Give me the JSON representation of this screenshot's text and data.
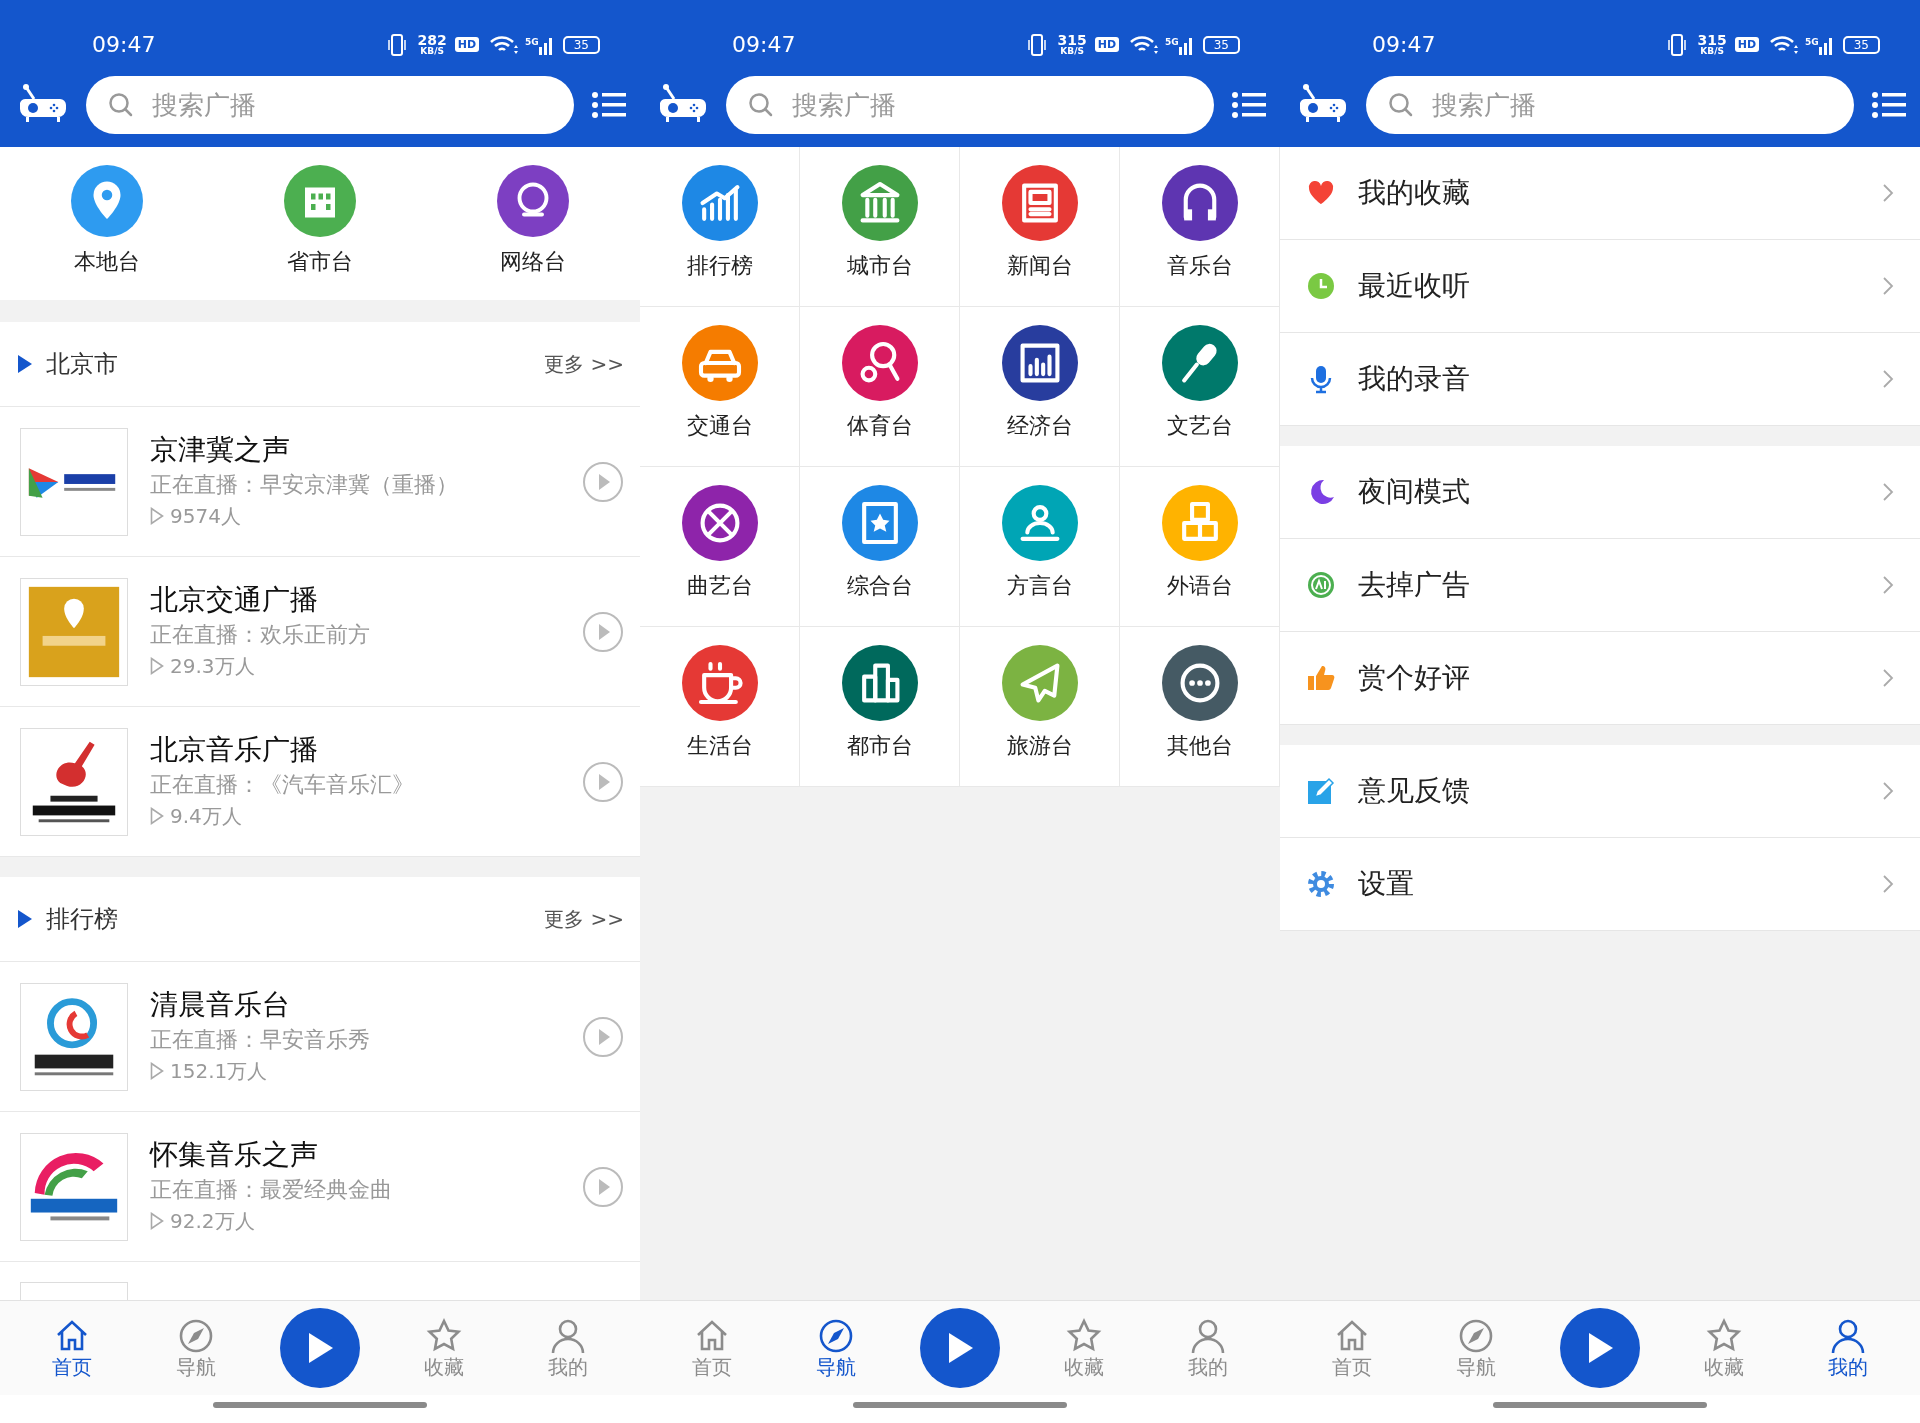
{
  "screens": [
    {
      "kind": "home",
      "status_bar": {
        "time": "09:47",
        "speed": "282",
        "speed_unit": "KB/S",
        "hd": "HD",
        "network": "5G",
        "battery": "35"
      },
      "search": {
        "placeholder": "搜索广播"
      },
      "categories": [
        {
          "label": "本地台",
          "color": "#2e9bf0"
        },
        {
          "label": "省市台",
          "color": "#4caf50"
        },
        {
          "label": "网络台",
          "color": "#7d3fc2"
        }
      ],
      "sections": [
        {
          "title": "北京市",
          "more": "更多 >>",
          "stations": [
            {
              "name": "京津冀之声",
              "now_playing": "正在直播：早安京津冀（重播）",
              "listeners": "9574人"
            },
            {
              "name": "北京交通广播",
              "now_playing": "正在直播：欢乐正前方",
              "listeners": "29.3万人"
            },
            {
              "name": "北京音乐广播",
              "now_playing": "正在直播：《汽车音乐汇》",
              "listeners": "9.4万人"
            }
          ]
        },
        {
          "title": "排行榜",
          "more": "更多 >>",
          "stations": [
            {
              "name": "清晨音乐台",
              "now_playing": "正在直播：早安音乐秀",
              "listeners": "152.1万人"
            },
            {
              "name": "怀集音乐之声",
              "now_playing": "正在直播：最爱经典金曲",
              "listeners": "92.2万人"
            }
          ]
        }
      ],
      "bottom_nav": [
        {
          "kind": "tab",
          "label": "首页",
          "selected": true
        },
        {
          "kind": "tab",
          "label": "导航",
          "selected": false
        },
        {
          "kind": "play"
        },
        {
          "kind": "tab",
          "label": "收藏",
          "selected": false
        },
        {
          "kind": "tab",
          "label": "我的",
          "selected": false
        }
      ]
    },
    {
      "kind": "navigate",
      "status_bar": {
        "time": "09:47",
        "speed": "315",
        "speed_unit": "KB/S",
        "hd": "HD",
        "network": "5G",
        "battery": "35"
      },
      "search": {
        "placeholder": "搜索广播"
      },
      "categories": [
        {
          "label": "排行榜",
          "color": "#1e88e5"
        },
        {
          "label": "城市台",
          "color": "#43a047"
        },
        {
          "label": "新闻台",
          "color": "#e53935"
        },
        {
          "label": "音乐台",
          "color": "#5e35b1"
        },
        {
          "label": "交通台",
          "color": "#f57c00"
        },
        {
          "label": "体育台",
          "color": "#d81b60"
        },
        {
          "label": "经济台",
          "color": "#283d9e"
        },
        {
          "label": "文艺台",
          "color": "#00796b"
        },
        {
          "label": "曲艺台",
          "color": "#8e24aa"
        },
        {
          "label": "综合台",
          "color": "#1e88e5"
        },
        {
          "label": "方言台",
          "color": "#00a5b5"
        },
        {
          "label": "外语台",
          "color": "#ffb300"
        },
        {
          "label": "生活台",
          "color": "#e53935"
        },
        {
          "label": "都市台",
          "color": "#00695c"
        },
        {
          "label": "旅游台",
          "color": "#7cb342"
        },
        {
          "label": "其他台",
          "color": "#455a64"
        }
      ],
      "bottom_nav": [
        {
          "kind": "tab",
          "label": "首页",
          "selected": false
        },
        {
          "kind": "tab",
          "label": "导航",
          "selected": true
        },
        {
          "kind": "play"
        },
        {
          "kind": "tab",
          "label": "收藏",
          "selected": false
        },
        {
          "kind": "tab",
          "label": "我的",
          "selected": false
        }
      ]
    },
    {
      "kind": "mine",
      "status_bar": {
        "time": "09:47",
        "speed": "315",
        "speed_unit": "KB/S",
        "hd": "HD",
        "network": "5G",
        "battery": "35"
      },
      "search": {
        "placeholder": "搜索广播"
      },
      "menu_groups": [
        [
          {
            "label": "我的收藏",
            "color": "#f44336"
          },
          {
            "label": "最近收听",
            "color": "#7ac943"
          },
          {
            "label": "我的录音",
            "color": "#1e6fe0"
          }
        ],
        [
          {
            "label": "夜间模式",
            "color": "#7b3fe4"
          },
          {
            "label": "去掉广告",
            "color": "#4caf50"
          },
          {
            "label": "赏个好评",
            "color": "#f7931e"
          }
        ],
        [
          {
            "label": "意见反馈",
            "color": "#29a3e8"
          },
          {
            "label": "设置",
            "color": "#3f8be0"
          }
        ]
      ],
      "bottom_nav": [
        {
          "kind": "tab",
          "label": "首页",
          "selected": false
        },
        {
          "kind": "tab",
          "label": "导航",
          "selected": false
        },
        {
          "kind": "play"
        },
        {
          "kind": "tab",
          "label": "收藏",
          "selected": false
        },
        {
          "kind": "tab",
          "label": "我的",
          "selected": true
        }
      ]
    }
  ]
}
